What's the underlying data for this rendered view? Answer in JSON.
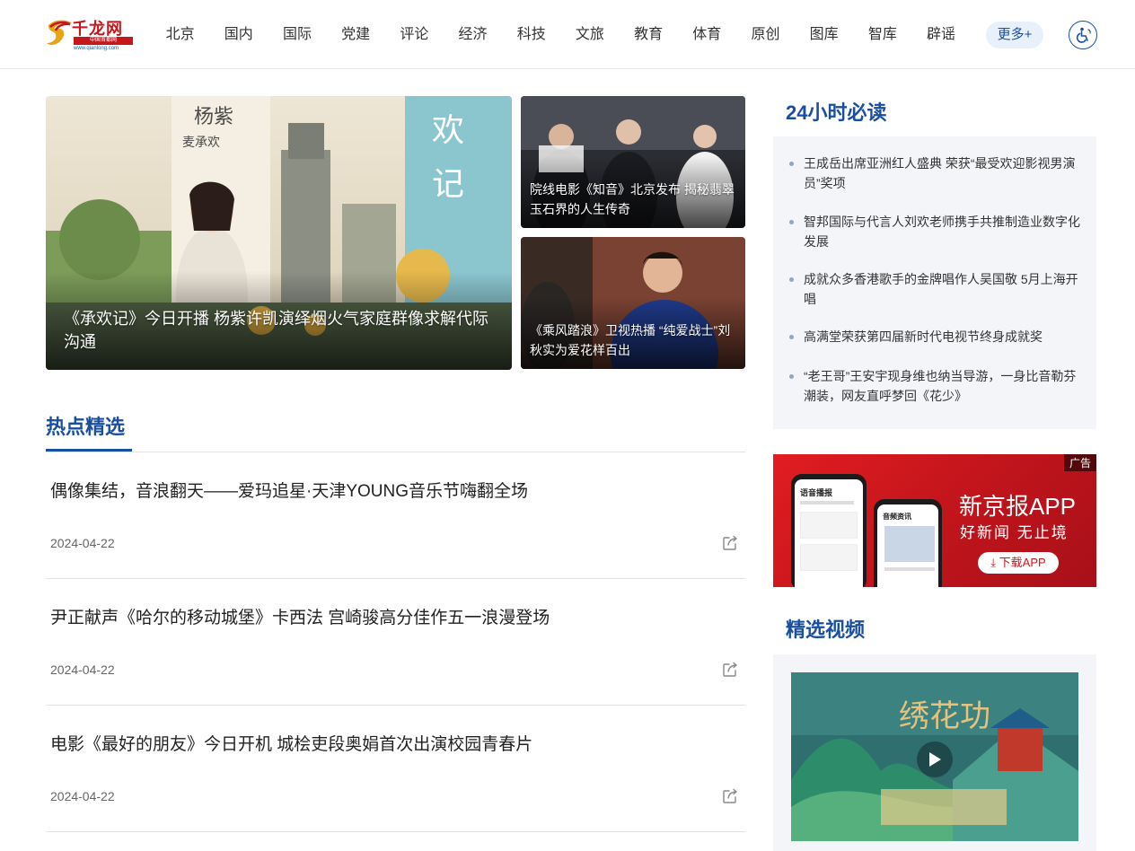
{
  "header": {
    "logo_text": "千龙网",
    "logo_subtext": "中国首都网",
    "logo_url_text": "www.qianlong.com",
    "nav": [
      "北京",
      "国内",
      "国际",
      "党建",
      "评论",
      "经济",
      "科技",
      "文旅",
      "教育",
      "体育",
      "原创",
      "图库",
      "智库",
      "辟谣"
    ],
    "more_label": "更多+",
    "accessibility_icon": "accessibility-icon"
  },
  "hero": {
    "main": {
      "caption": "《承欢记》今日开播 杨紫许凯演绎烟火气家庭群像求解代际沟通"
    },
    "side": [
      {
        "caption": "院线电影《知音》北京发布 揭秘翡翠玉石界的人生传奇"
      },
      {
        "caption": "《乘风踏浪》卫视热播 “纯爱战士”刘秋实为爱花样百出"
      }
    ]
  },
  "hot": {
    "title": "热点精选",
    "items": [
      {
        "title": "偶像集结，音浪翻天——爱玛追星·天津YOUNG音乐节嗨翻全场",
        "date": "2024-04-22"
      },
      {
        "title": "尹正献声《哈尔的移动城堡》卡西法 宫崎骏高分佳作五一浪漫登场",
        "date": "2024-04-22"
      },
      {
        "title": "电影《最好的朋友》今日开机 城桧吏段奥娟首次出演校园青春片",
        "date": "2024-04-22"
      }
    ]
  },
  "read24": {
    "title": "24小时必读",
    "items": [
      "王成岳出席亚洲红人盛典 荣获“最受欢迎影视男演员”奖项",
      "智邦国际与代言人刘欢老师携手共推制造业数字化发展",
      "成就众多香港歌手的金牌唱作人吴国敬 5月上海开唱",
      "高满堂荣获第四届新时代电视节终身成就奖",
      "“老王哥”王安宇现身维也纳当导游，一身比音勒芬潮装，网友直呼梦回《花少》"
    ]
  },
  "ad": {
    "label": "广告",
    "app_name": "新京报APP",
    "slogan": "好新闻  无止境",
    "download": "下载APP",
    "phone1_header": "语音播报",
    "phone2_header": "音频资讯"
  },
  "video": {
    "title": "精选视频"
  },
  "colors": {
    "brand_blue": "#1a4fa0",
    "brand_red": "#c8161d",
    "panel_bg": "#f3f5f8"
  }
}
